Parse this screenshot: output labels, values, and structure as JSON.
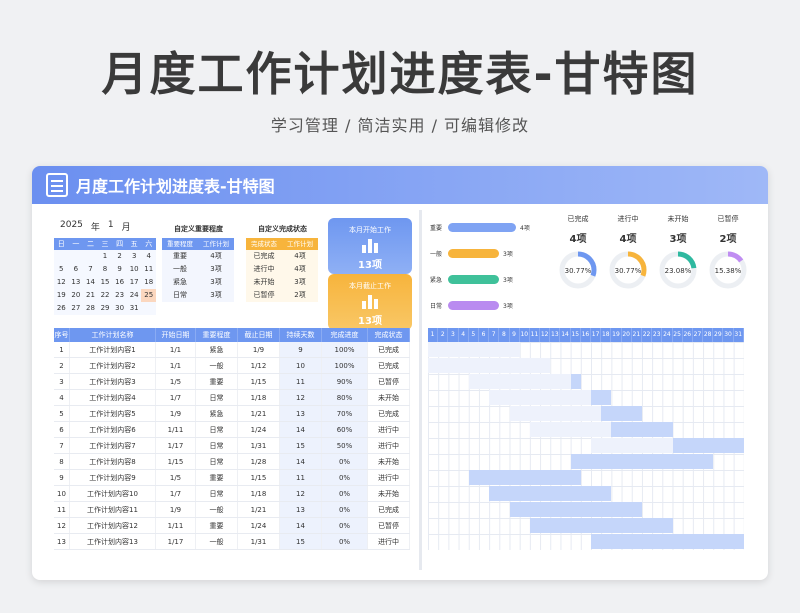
{
  "page": {
    "title": "月度工作计划进度表-甘特图",
    "subtitle": "学习管理 /  简洁实用  /  可编辑修改"
  },
  "sheet": {
    "title": "月度工作计划进度表-甘特图"
  },
  "calendar": {
    "year": "2025",
    "year_unit": "年",
    "month": "1",
    "month_unit": "月",
    "weekdays": [
      "日",
      "一",
      "二",
      "三",
      "四",
      "五",
      "六"
    ],
    "weeks": [
      [
        "",
        "",
        "",
        "1",
        "2",
        "3",
        "4"
      ],
      [
        "5",
        "6",
        "7",
        "8",
        "9",
        "10",
        "11"
      ],
      [
        "12",
        "13",
        "14",
        "15",
        "16",
        "17",
        "18"
      ],
      [
        "19",
        "20",
        "21",
        "22",
        "23",
        "24",
        "25"
      ],
      [
        "26",
        "27",
        "28",
        "29",
        "30",
        "31",
        ""
      ]
    ],
    "today": "25"
  },
  "priority_table": {
    "title": "自定义重要程度",
    "headers": [
      "重要程度",
      "工作计划"
    ],
    "rows": [
      [
        "重要",
        "4项"
      ],
      [
        "一般",
        "3项"
      ],
      [
        "紧急",
        "3项"
      ],
      [
        "日常",
        "3项"
      ]
    ]
  },
  "status_table": {
    "title": "自定义完成状态",
    "headers": [
      "完成状态",
      "工作计划"
    ],
    "rows": [
      [
        "已完成",
        "4项"
      ],
      [
        "进行中",
        "4项"
      ],
      [
        "未开始",
        "3项"
      ],
      [
        "已暂停",
        "2项"
      ]
    ]
  },
  "cards": [
    {
      "title": "本月开始工作",
      "value": "13项",
      "color": "#6e97f0"
    },
    {
      "title": "本月截止工作",
      "value": "13项",
      "color": "#f7b43c"
    }
  ],
  "main_table": {
    "headers": [
      "序号",
      "工作计划名称",
      "开始日期",
      "重要程度",
      "截止日期",
      "持续天数",
      "完成进度",
      "完成状态"
    ],
    "rows": [
      [
        "1",
        "工作计划内容1",
        "1/1",
        "紧急",
        "1/9",
        "9",
        "100%",
        "已完成"
      ],
      [
        "2",
        "工作计划内容2",
        "1/1",
        "一般",
        "1/12",
        "10",
        "100%",
        "已完成"
      ],
      [
        "3",
        "工作计划内容3",
        "1/5",
        "重要",
        "1/15",
        "11",
        "90%",
        "已暂停"
      ],
      [
        "4",
        "工作计划内容4",
        "1/7",
        "日常",
        "1/18",
        "12",
        "80%",
        "未开始"
      ],
      [
        "5",
        "工作计划内容5",
        "1/9",
        "紧急",
        "1/21",
        "13",
        "70%",
        "已完成"
      ],
      [
        "6",
        "工作计划内容6",
        "1/11",
        "日常",
        "1/24",
        "14",
        "60%",
        "进行中"
      ],
      [
        "7",
        "工作计划内容7",
        "1/17",
        "日常",
        "1/31",
        "15",
        "50%",
        "进行中"
      ],
      [
        "8",
        "工作计划内容8",
        "1/15",
        "日常",
        "1/28",
        "14",
        "0%",
        "未开始"
      ],
      [
        "9",
        "工作计划内容9",
        "1/5",
        "重要",
        "1/15",
        "11",
        "0%",
        "进行中"
      ],
      [
        "10",
        "工作计划内容10",
        "1/7",
        "日常",
        "1/18",
        "12",
        "0%",
        "未开始"
      ],
      [
        "11",
        "工作计划内容11",
        "1/9",
        "一般",
        "1/21",
        "13",
        "0%",
        "已完成"
      ],
      [
        "12",
        "工作计划内容12",
        "1/11",
        "重要",
        "1/24",
        "14",
        "0%",
        "已暂停"
      ],
      [
        "13",
        "工作计划内容13",
        "1/17",
        "一般",
        "1/31",
        "15",
        "0%",
        "进行中"
      ]
    ]
  },
  "priority_bars": [
    {
      "label": "重要",
      "value": "4项",
      "count": 4,
      "color": "#7fa3f3"
    },
    {
      "label": "一般",
      "value": "3项",
      "count": 3,
      "color": "#f7b43c"
    },
    {
      "label": "紧急",
      "value": "3项",
      "count": 3,
      "color": "#3fc19a"
    },
    {
      "label": "日常",
      "value": "3项",
      "count": 3,
      "color": "#b98bf0"
    }
  ],
  "status_donuts": [
    {
      "label": "已完成",
      "count": "4项",
      "percent": "30.77%",
      "fraction": 0.3077,
      "color": "#6e97f0"
    },
    {
      "label": "进行中",
      "count": "4项",
      "percent": "30.77%",
      "fraction": 0.3077,
      "color": "#f7b43c"
    },
    {
      "label": "未开始",
      "count": "3项",
      "percent": "23.08%",
      "fraction": 0.2308,
      "color": "#2fb9a0"
    },
    {
      "label": "已暂停",
      "count": "2项",
      "percent": "15.38%",
      "fraction": 0.1538,
      "color": "#c08df2"
    }
  ],
  "gantt": {
    "days": [
      "1",
      "2",
      "3",
      "4",
      "5",
      "6",
      "7",
      "8",
      "9",
      "10",
      "11",
      "12",
      "13",
      "14",
      "15",
      "16",
      "17",
      "18",
      "19",
      "20",
      "21",
      "22",
      "23",
      "24",
      "25",
      "26",
      "27",
      "28",
      "29",
      "30",
      "31"
    ]
  }
}
